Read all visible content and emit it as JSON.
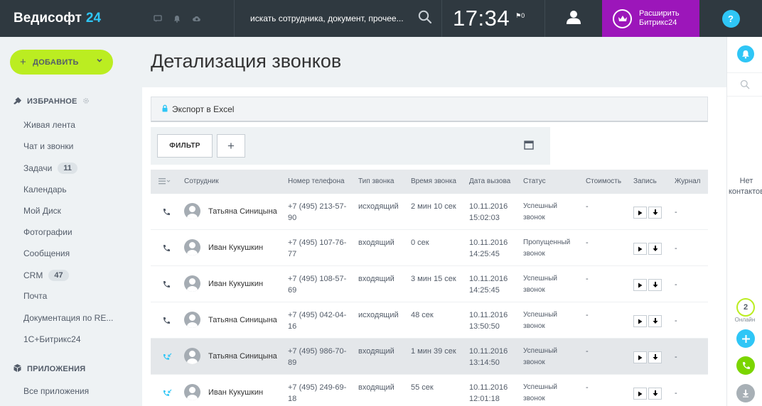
{
  "header": {
    "logo": "Ведисофт",
    "logo_num": "24",
    "search_placeholder": "искать сотрудника, документ, прочее...",
    "time": "17:34",
    "flag_count": "0",
    "upgrade_line1": "Расширить",
    "upgrade_line2": "Битрикс24",
    "help": "?"
  },
  "sidebar": {
    "add_button": "ДОБАВИТЬ",
    "favorites_title": "ИЗБРАННОЕ",
    "items": [
      {
        "label": "Живая лента"
      },
      {
        "label": "Чат и звонки"
      },
      {
        "label": "Задачи",
        "counter": "11"
      },
      {
        "label": "Календарь"
      },
      {
        "label": "Мой Диск"
      },
      {
        "label": "Фотографии"
      },
      {
        "label": "Сообщения"
      },
      {
        "label": "CRM",
        "counter": "47"
      },
      {
        "label": "Почта"
      },
      {
        "label": "Документация по RE..."
      },
      {
        "label": "1С+Битрикс24"
      }
    ],
    "apps_title": "ПРИЛОЖЕНИЯ",
    "apps_items": [
      {
        "label": "Все приложения"
      }
    ]
  },
  "main": {
    "title": "Детализация звонков",
    "export_label": "Экспорт в Excel",
    "filter_button": "ФИЛЬТР",
    "add_filter": "+"
  },
  "grid": {
    "columns": [
      "Сотрудник",
      "Номер телефона",
      "Тип звонка",
      "Время звонка",
      "Дата вызова",
      "Статус",
      "Стоимость",
      "Запись",
      "Журнал"
    ],
    "rows": [
      {
        "icon": "outgoing-call-icon",
        "employee": "Татьяна Синицына",
        "phone1": "+7 (495) 213-57-",
        "phone2": "90",
        "type": "исходящий",
        "duration": "2 мин 10 сек",
        "date": "10.11.2016",
        "time": "15:02:03",
        "status1": "Успешный",
        "status2": "звонок",
        "cost": "-",
        "journal": "-"
      },
      {
        "icon": "incoming-call-icon",
        "employee": "Иван Кукушкин",
        "phone1": "+7 (495) 107-76-",
        "phone2": "77",
        "type": "входящий",
        "duration": "0 сек",
        "date": "10.11.2016",
        "time": "14:25:45",
        "status1": "Пропущенный",
        "status2": "звонок",
        "cost": "-",
        "journal": "-"
      },
      {
        "icon": "incoming-call-icon",
        "employee": "Иван Кукушкин",
        "phone1": "+7 (495) 108-57-",
        "phone2": "69",
        "type": "входящий",
        "duration": "3 мин 15 сек",
        "date": "10.11.2016",
        "time": "14:25:45",
        "status1": "Успешный",
        "status2": "звонок",
        "cost": "-",
        "journal": "-"
      },
      {
        "icon": "outgoing-call-icon",
        "employee": "Татьяна Синицына",
        "phone1": "+7 (495) 042-04-",
        "phone2": "16",
        "type": "исходящий",
        "duration": "48 сек",
        "date": "10.11.2016",
        "time": "13:50:50",
        "status1": "Успешный",
        "status2": "звонок",
        "cost": "-",
        "journal": "-"
      },
      {
        "icon": "incoming-arrow-call-icon",
        "employee": "Татьяна Синицына",
        "phone1": "+7 (495) 986-70-",
        "phone2": "89",
        "type": "входящий",
        "duration": "1 мин 39 сек",
        "date": "10.11.2016",
        "time": "13:14:50",
        "status1": "Успешный",
        "status2": "звонок",
        "cost": "-",
        "journal": "-"
      },
      {
        "icon": "incoming-arrow-call-icon",
        "employee": "Иван Кукушкин",
        "phone1": "+7 (495) 249-69-",
        "phone2": "18",
        "type": "входящий",
        "duration": "55 сек",
        "date": "10.11.2016",
        "time": "12:01:18",
        "status1": "Успешный",
        "status2": "звонок",
        "cost": "-",
        "journal": "-"
      }
    ]
  },
  "right_panel": {
    "no_contacts_1": "Нет",
    "no_contacts_2": "контактов",
    "online_count": "2",
    "online_label": "Онлайн"
  },
  "colors": {
    "topbar": "#2f3940",
    "accent_blue": "#2fc6f6",
    "add_green": "#bbed21",
    "upgrade_purple": "#9c16ba",
    "call_green": "#7bd500"
  }
}
